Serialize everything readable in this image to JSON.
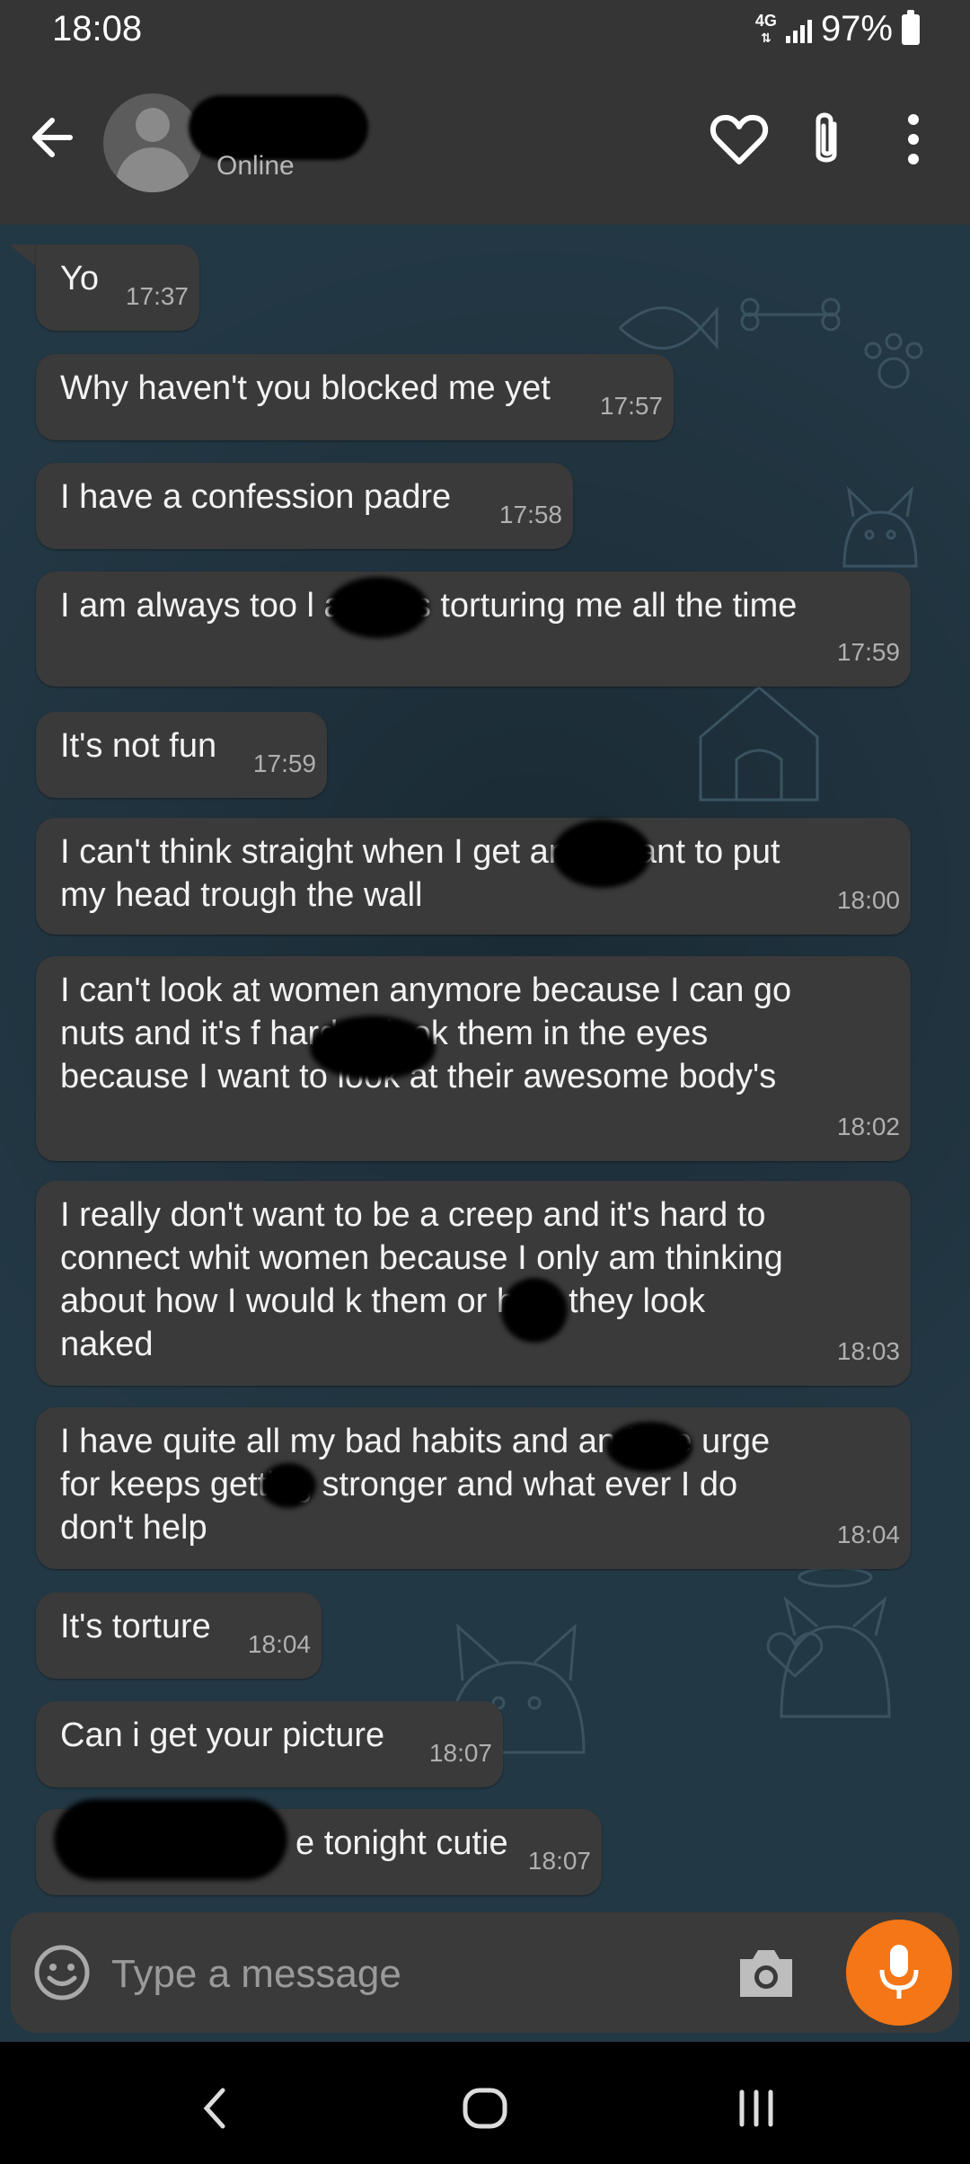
{
  "status_bar": {
    "time": "18:08",
    "network": "4G",
    "battery": "97%"
  },
  "header": {
    "back_icon": "arrow-left-icon",
    "contact_name": "",
    "presence": "Online",
    "favorite_icon": "heart-outline-icon",
    "attach_icon": "paperclip-icon",
    "menu_icon": "more-vertical-icon"
  },
  "messages": [
    {
      "text": "Yo",
      "time": "17:37"
    },
    {
      "text": "Why haven't you blocked me yet",
      "time": "17:57"
    },
    {
      "text": "I have a confession padre",
      "time": "17:58"
    },
    {
      "text": "I am always too l      and it's torturing me all the time",
      "time": "17:59"
    },
    {
      "text": "It's not fun",
      "time": "17:59"
    },
    {
      "text": "I can't think straight when I get      and i want to put my head trough the wall",
      "time": "18:00"
    },
    {
      "text": "I can't look at women anymore because I can go nuts and it's f      hard to look them in the eyes because I want to look at their awesome body's",
      "time": "18:02"
    },
    {
      "text": "I really don't want to be a creep and it's hard to connect whit women because I only am thinking about how I would   k them or how they look naked",
      "time": "18:03"
    },
    {
      "text": "I have quite all my bad habits and      and the urge for     keeps getting stronger and what ever I do don't help",
      "time": "18:04"
    },
    {
      "text": "It's torture",
      "time": "18:04"
    },
    {
      "text": "Can i get your picture",
      "time": "18:07"
    },
    {
      "text": "e tonight cutie",
      "time": "18:07"
    }
  ],
  "composer": {
    "placeholder": "Type a message",
    "emoji_icon": "emoji-icon",
    "camera_icon": "camera-icon",
    "mic_icon": "microphone-icon",
    "mic_color": "#f57616"
  },
  "nav_bar": {
    "back": "nav-back-icon",
    "home": "nav-home-icon",
    "recents": "nav-recents-icon"
  },
  "colors": {
    "bubble": "#3a3a3a",
    "chat_bg": "#233845",
    "bar": "#353535"
  }
}
